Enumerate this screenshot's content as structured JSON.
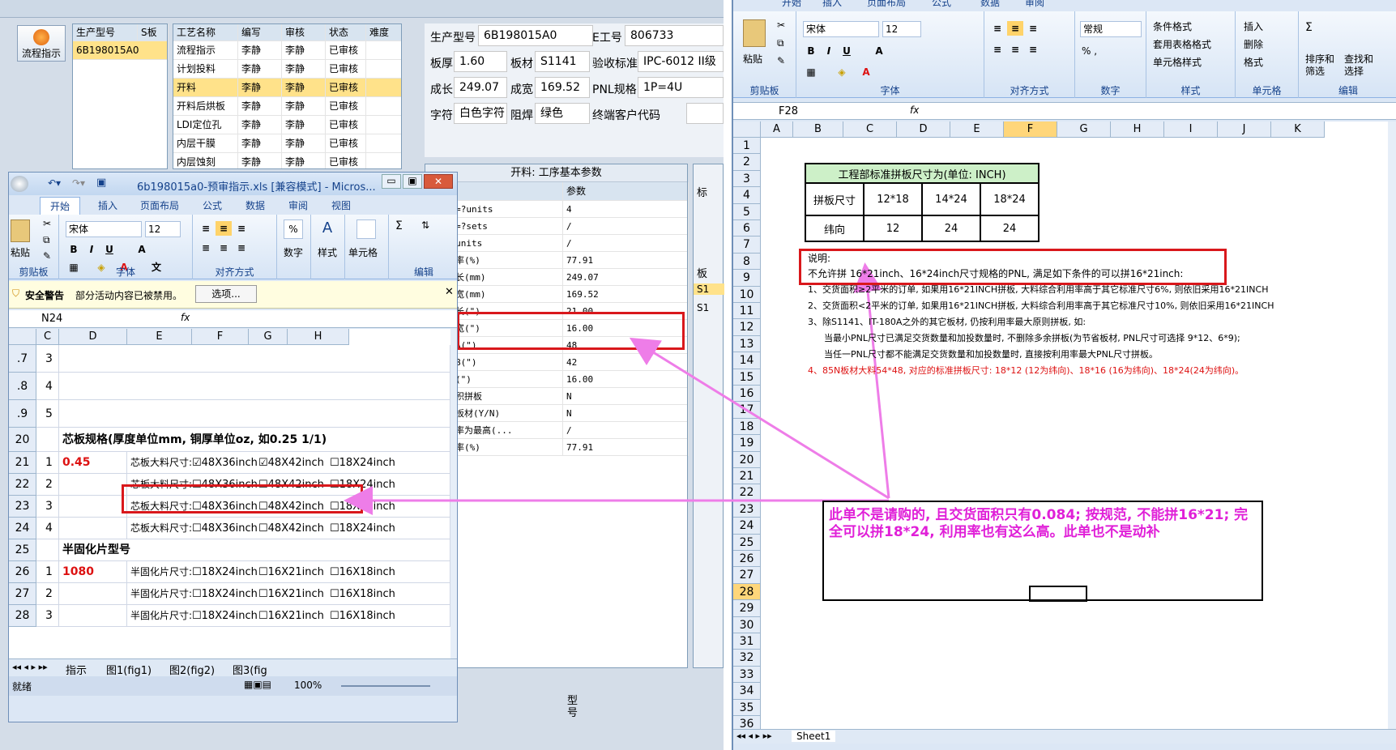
{
  "left_app": {
    "flow_button": "流程指示",
    "order_table": {
      "headers": [
        "生产型号",
        "S板"
      ],
      "rows": [
        [
          "6B198015A0",
          ""
        ]
      ]
    },
    "process_table": {
      "headers": [
        "工艺名称",
        "编写",
        "审核",
        "状态",
        "难度"
      ],
      "rows": [
        [
          "流程指示",
          "李静",
          "李静",
          "已审核",
          ""
        ],
        [
          "计划投料",
          "李静",
          "李静",
          "已审核",
          ""
        ],
        [
          "开料",
          "李静",
          "李静",
          "已审核",
          ""
        ],
        [
          "开料后烘板",
          "李静",
          "李静",
          "已审核",
          ""
        ],
        [
          "LDI定位孔",
          "李静",
          "李静",
          "已审核",
          ""
        ],
        [
          "内层干膜",
          "李静",
          "李静",
          "已审核",
          ""
        ],
        [
          "内层蚀刻",
          "李静",
          "李静",
          "已审核",
          ""
        ]
      ]
    },
    "info": {
      "model_label": "生产型号",
      "model_value": "6B198015A0",
      "eno_label": "E工号",
      "eno_value": "806733",
      "thick_label": "板厚",
      "thick_value": "1.60",
      "mat_label": "板材",
      "mat_value": "S1141",
      "std_label": "验收标准",
      "std_value": "IPC-6012 II级",
      "len_label": "成长",
      "len_value": "249.07",
      "wid_label": "成宽",
      "wid_value": "169.52",
      "pnl_label": "PNL规格",
      "pnl_value": "1P=4U",
      "char_label": "字符",
      "char_value": "白色字符",
      "mask_label": "阻焊",
      "mask_value": "绿色",
      "cust_label": "终端客户代码",
      "cust_value": ""
    },
    "params": {
      "title": "开料: 工序基本参数",
      "col1": "目",
      "col2": "参数",
      "rows": [
        [
          "PANEL=?units",
          "4"
        ],
        [
          "PANEL=?sets",
          "/"
        ],
        [
          "SET=?units",
          "/"
        ],
        [
          "料利用率(%)",
          "77.91"
        ],
        [
          "品尺寸长(mm)",
          "249.07"
        ],
        [
          "品尺寸宽(mm)",
          "169.52"
        ],
        [
          "产尺寸长(\")",
          "21.00"
        ],
        [
          "产尺寸宽(\")",
          "16.00"
        ],
        [
          "料尺寸A(\")",
          "48"
        ],
        [
          "料尺寸B(\")",
          "42"
        ],
        [
          "向尺寸(\")",
          "16.00"
        ],
        [
          "交货面积拼板",
          "N"
        ],
        [
          "客指定板材(Y/N)",
          "N"
        ],
        [
          "合利用率为最高(...",
          "/"
        ],
        [
          "合利用率(%)",
          "77.91"
        ]
      ]
    },
    "side_labels": [
      "标",
      "板",
      "S1",
      "S1"
    ],
    "bottom_label": "型号"
  },
  "small_excel": {
    "title": "6b198015a0-预审指示.xls [兼容模式] - Micros...",
    "tabs": [
      "开始",
      "插入",
      "页面布局",
      "公式",
      "数据",
      "审阅",
      "视图"
    ],
    "font_name": "宋体",
    "font_size": "12",
    "groups": [
      "剪贴板",
      "字体",
      "对齐方式",
      "数字",
      "样式",
      "单元格",
      "编辑"
    ],
    "btns": {
      "paste": "粘贴",
      "number": "数字",
      "style": "样式",
      "cells": "单元格"
    },
    "security_title": "安全警告",
    "security_msg": "部分活动内容已被禁用。",
    "options_btn": "选项...",
    "namebox": "N24",
    "col_heads": [
      "B",
      "C",
      "D",
      "E",
      "F",
      "G",
      "H"
    ],
    "rows": [
      {
        "num": ".7",
        "b": "3",
        "c": ""
      },
      {
        "num": ".8",
        "b": "4",
        "c": ""
      },
      {
        "num": ".9",
        "b": "5",
        "c": ""
      }
    ],
    "section1": "芯板规格(厚度单位mm, 铜厚单位oz, 如0.25 1/1)",
    "core_rows": [
      {
        "num": "21",
        "b": "1",
        "c": "0.45",
        "label": "芯板大料尺寸:",
        "o1": "48X36inch",
        "o2": "48X42inch",
        "o3": "18X24inch"
      },
      {
        "num": "22",
        "b": "2",
        "c": "",
        "label": "芯板大料尺寸:",
        "o1": "48X36inch",
        "o2": "48X42inch",
        "o3": "18X24inch"
      },
      {
        "num": "23",
        "b": "3",
        "c": "",
        "label": "芯板大料尺寸:",
        "o1": "48X36inch",
        "o2": "48X42inch",
        "o3": "18X24inch"
      },
      {
        "num": "24",
        "b": "4",
        "c": "",
        "label": "芯板大料尺寸:",
        "o1": "48X36inch",
        "o2": "48X42inch",
        "o3": "18X24inch"
      }
    ],
    "section2": "半固化片型号",
    "pp_rows": [
      {
        "num": "26",
        "b": "1",
        "c": "1080",
        "label": "半固化片尺寸:",
        "o1": "18X24inch",
        "o2": "16X21inch",
        "o3": "16X18inch"
      },
      {
        "num": "27",
        "b": "2",
        "c": "",
        "label": "半固化片尺寸:",
        "o1": "18X24inch",
        "o2": "16X21inch",
        "o3": "16X18inch"
      },
      {
        "num": "28",
        "b": "3",
        "c": "",
        "label": "半固化片尺寸:",
        "o1": "18X24inch",
        "o2": "16X21inch",
        "o3": "16X18inch"
      }
    ],
    "row20": "20",
    "row25": "25",
    "sheet_tabs": [
      "指示",
      "图1(fig1)",
      "图2(fig2)",
      "图3(fig"
    ],
    "status": "就绪",
    "zoom": "100%"
  },
  "big_excel": {
    "top_tabs": [
      "开始",
      "插入",
      "页面布局",
      "公式",
      "数据",
      "审阅"
    ],
    "font_name": "宋体",
    "font_size": "12",
    "number_format": "常规",
    "groups": [
      "剪贴板",
      "字体",
      "对齐方式",
      "数字",
      "样式",
      "单元格",
      "编辑"
    ],
    "btns": {
      "paste": "粘贴",
      "cond": "条件格式",
      "table": "套用表格格式",
      "cellstyle": "单元格样式",
      "insert": "插入",
      "delete": "删除",
      "format": "格式",
      "sort": "排序和筛选",
      "find": "查找和选择"
    },
    "namebox": "F28",
    "col_heads": [
      "A",
      "B",
      "C",
      "D",
      "E",
      "F",
      "G",
      "H",
      "I",
      "J",
      "K"
    ],
    "row_nums": [
      "1",
      "2",
      "3",
      "4",
      "5",
      "6",
      "7",
      "8",
      "9",
      "10",
      "11",
      "12",
      "13",
      "14",
      "15",
      "16",
      "17",
      "18",
      "19",
      "20",
      "21",
      "22",
      "23",
      "24",
      "25",
      "26",
      "27",
      "28",
      "29",
      "30",
      "31",
      "32",
      "33",
      "34",
      "35",
      "36"
    ],
    "table": {
      "title": "工程部标准拼板尺寸为(单位: INCH)",
      "r1": [
        "拼板尺寸",
        "12*18",
        "14*24",
        "18*24"
      ],
      "r2": [
        "纬向",
        "12",
        "24",
        "24"
      ]
    },
    "note_title": "说明:",
    "note_line": "不允许拼 16*21inch、16*24inch尺寸规格的PNL, 满足如下条件的可以拼16*21inch:",
    "lines": [
      "1、交货面积≥2平米的订单, 如果用16*21INCH拼板, 大料综合利用率高于其它标准尺寸6%, 则依旧采用16*21INCH",
      "2、交货面积<2平米的订单, 如果用16*21INCH拼板, 大料综合利用率高于其它标准尺寸10%, 则依旧采用16*21INCH",
      "3、除S1141、IT-180A之外的其它板材, 仍按利用率最大原则拼板, 如:",
      "当最小PNL尺寸已满足交货数量和加投数量时, 不删除多余拼板(为节省板材, PNL尺寸可选择 9*12、6*9);",
      "当任一PNL尺寸都不能满足交货数量和加投数量时, 直接按利用率最大PNL尺寸拼板。",
      "4、85N板材大料54*48, 对应的标准拼板尺寸: 18*12 (12为纬向)、18*16 (16为纬向)、18*24(24为纬向)。"
    ],
    "comment": "此单不是请购的, 且交货面积只有0.084; 按规范, 不能拼16*21; 完全可以拼18*24, 利用率也有这么高。此单也不是动补",
    "sheet_tab": "Sheet1"
  }
}
